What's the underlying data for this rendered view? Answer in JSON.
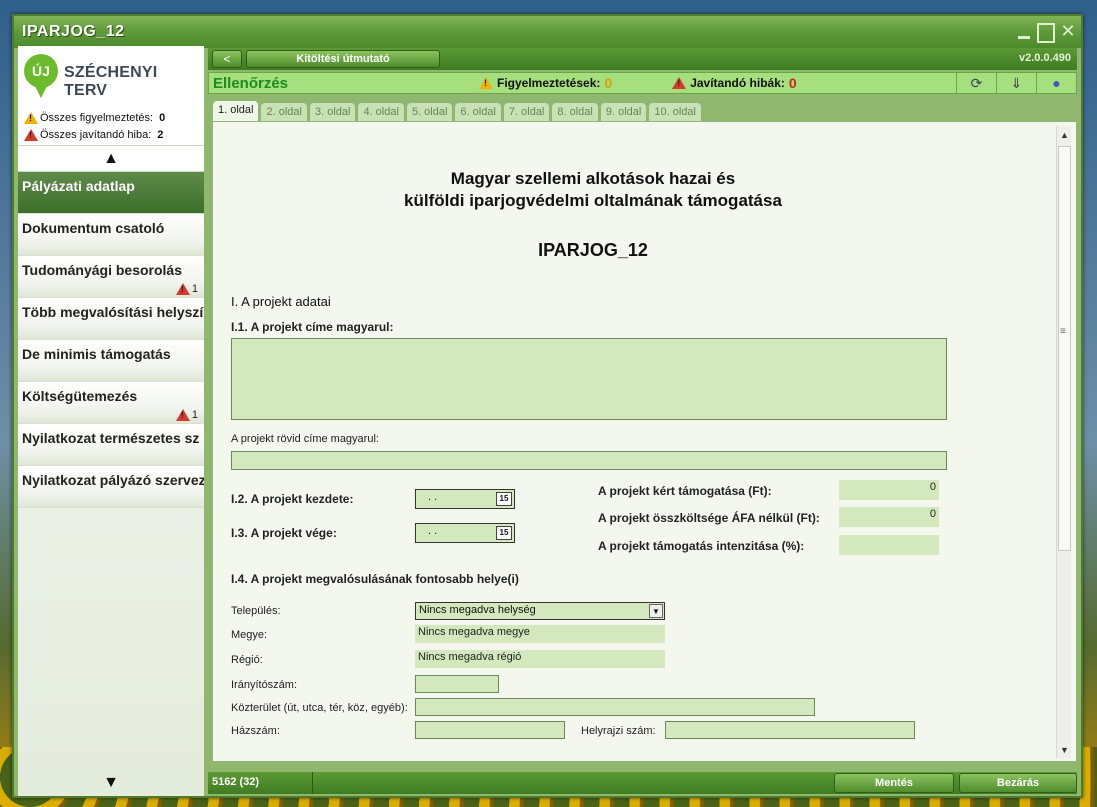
{
  "window": {
    "title": "IPARJOG_12"
  },
  "logo": {
    "mark": "ÚJ",
    "text": "SZÉCHENYI TERV"
  },
  "summary": {
    "warnings_label": "Összes figyelmeztetés:",
    "warnings_count": "0",
    "errors_label": "Összes javítandó hiba:",
    "errors_count": "2"
  },
  "nav": {
    "up_arrow": "▲",
    "down_arrow": "▼",
    "items": [
      {
        "label": "Pályázati adatlap",
        "badge": ""
      },
      {
        "label": "Dokumentum csatoló",
        "badge": ""
      },
      {
        "label": "Tudományági besorolás",
        "badge": "1"
      },
      {
        "label": "Több megvalósítási helyszín",
        "badge": ""
      },
      {
        "label": "De minimis támogatás",
        "badge": ""
      },
      {
        "label": "Költségütemezés",
        "badge": "1"
      },
      {
        "label": "Nyilatkozat természetes sz",
        "badge": ""
      },
      {
        "label": "Nyilatkozat pályázó szervez",
        "badge": ""
      }
    ]
  },
  "topbar": {
    "back": "<",
    "guide": "Kitöltési útmutató",
    "version": "v2.0.0.490"
  },
  "checkbar": {
    "title": "Ellenőrzés",
    "warnings_label": "Figyelmeztetések:",
    "warnings_count": "0",
    "errors_label": "Javítandó hibák:",
    "errors_count": "0"
  },
  "tabs": [
    "1. oldal",
    "2. oldal",
    "3. oldal",
    "4. oldal",
    "5. oldal",
    "6. oldal",
    "7. oldal",
    "8. oldal",
    "9. oldal",
    "10. oldal"
  ],
  "form": {
    "title_line1": "Magyar szellemi alkotások hazai és",
    "title_line2": "külföldi iparjogvédelmi oltalmának támogatása",
    "code": "IPARJOG_12",
    "section1": "I. A projekt adatai",
    "title_hu_label": "I.1. A projekt címe magyarul:",
    "title_hu_value": "",
    "short_title_label": "A projekt rövid címe magyarul:",
    "short_title_value": "",
    "start_label": "I.2. A projekt kezdete:",
    "start_value": ". .",
    "end_label": "I.3. A projekt vége:",
    "end_value": ". .",
    "cal_icon": "15",
    "requested_label": "A projekt kért támogatása (Ft):",
    "requested_value": "0",
    "total_label": "A projekt összköltsége ÁFA nélkül (Ft):",
    "total_value": "0",
    "intensity_label": "A projekt támogatás intenzitása (%):",
    "intensity_value": "",
    "location_label": "I.4. A projekt megvalósulásának fontosabb helye(i)",
    "settlement_label": "Település:",
    "settlement_value": "Nincs megadva helység",
    "county_label": "Megye:",
    "county_value": "Nincs megadva megye",
    "region_label": "Régió:",
    "region_value": "Nincs megadva régió",
    "zip_label": "Irányítószám:",
    "street_label": "Közterület (út, utca, tér, köz, egyéb):",
    "house_label": "Házszám:",
    "lot_label": "Helyrajzi szám:"
  },
  "statusbar": {
    "text": "5162 (32)",
    "save": "Mentés",
    "close": "Bezárás"
  }
}
